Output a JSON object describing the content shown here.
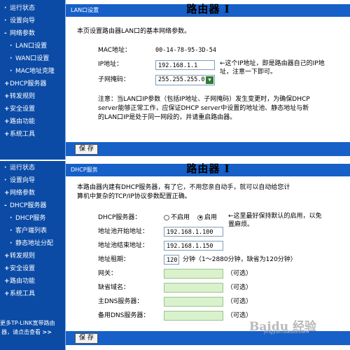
{
  "router_title": "路由器 I",
  "sidebar_top": {
    "items": [
      {
        "mark": "·",
        "label": "运行状态"
      },
      {
        "mark": "·",
        "label": "设置向导"
      },
      {
        "mark": "-",
        "label": "网络参数"
      },
      {
        "mark": "·",
        "label": "LAN口设置"
      },
      {
        "mark": "·",
        "label": "WAN口设置"
      },
      {
        "mark": "·",
        "label": "MAC地址克隆"
      },
      {
        "mark": "+",
        "label": "DHCP服务器"
      },
      {
        "mark": "+",
        "label": "转发规则"
      },
      {
        "mark": "+",
        "label": "安全设置"
      },
      {
        "mark": "+",
        "label": "路由功能"
      },
      {
        "mark": "+",
        "label": "系统工具"
      }
    ]
  },
  "sidebar_bottom": {
    "items": [
      {
        "mark": "·",
        "label": "运行状态"
      },
      {
        "mark": "·",
        "label": "设置向导"
      },
      {
        "mark": "+",
        "label": "网络参数"
      },
      {
        "mark": "-",
        "label": "DHCP服务器"
      },
      {
        "mark": "·",
        "label": "DHCP服务"
      },
      {
        "mark": "·",
        "label": "客户端列表"
      },
      {
        "mark": "·",
        "label": "静态地址分配"
      },
      {
        "mark": "+",
        "label": "转发规则"
      },
      {
        "mark": "+",
        "label": "安全设置"
      },
      {
        "mark": "+",
        "label": "路由功能"
      },
      {
        "mark": "+",
        "label": "系统工具"
      }
    ],
    "footer_line1": "更多TP-LINK宽带路由",
    "footer_line2": "器，请点击查看",
    "footer_arrows": ">>"
  },
  "lan": {
    "header": "LAN口设置",
    "intro": "本页设置路由器LAN口的基本网络参数。",
    "mac_label": "MAC地址：",
    "mac_value": "00-14-78-95-3D-54",
    "ip_label": "IP地址：",
    "ip_value": "192.168.1.1",
    "ip_note_line1": "←这个IP地址，即是路由器自己的IP地",
    "ip_note_line2": "址，注意一下即可。",
    "mask_label": "子网掩码：",
    "mask_value": "255.255.255.0",
    "notice_line1": "注意：当LAN口IP参数（包括IP地址、子网掩码）发生变更时，为确保DHCP",
    "notice_line2": "server能够正常工作，应保证DHCP server中设置的地址池、静态地址与新",
    "notice_line3": "的LAN口IP是处于同一网段的，并请重启路由器。",
    "save": "保 存"
  },
  "dhcp": {
    "header": "DHCP服务",
    "intro_line1": "本路由器内建有DHCP服务器，有了它，不用您亲自动手，就可以自动给您计",
    "intro_line2": "算机中复杂的TCP/IP协议参数配置正确。",
    "server_label": "DHCP服务器：",
    "opt_disable": "不启用",
    "opt_enable": "启用",
    "server_note_line1": "←这里最好保持默认的启用，以免",
    "server_note_line2": "置麻烦。",
    "pool_start_label": "地址池开始地址：",
    "pool_start_value": "192.168.1.100",
    "pool_end_label": "地址池结束地址：",
    "pool_end_value": "192.168.1.150",
    "lease_label": "地址租期：",
    "lease_value": "120",
    "lease_hint": "分钟（1～2880分钟，缺省为120分钟）",
    "gateway_label": "网关：",
    "domain_label": "缺省域名：",
    "dns1_label": "主DNS服务器：",
    "dns2_label": "备用DNS服务器：",
    "optional": "（可选）",
    "save": "保 存"
  },
  "watermark": "Baidu 经验",
  "watermark_url": "jingyan.baidu.com"
}
